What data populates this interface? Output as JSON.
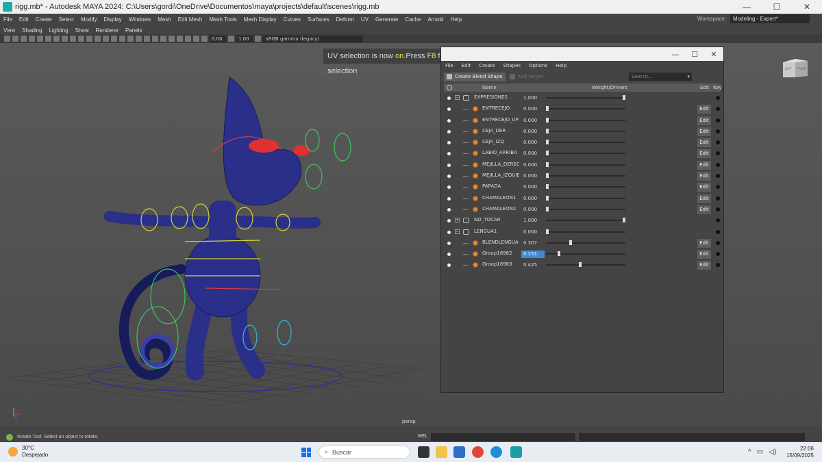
{
  "window": {
    "title": "rigg.mb* - Autodesk MAYA 2024: C:\\Users\\gordi\\OneDrive\\Documentos\\maya\\projects\\default\\scenes\\rigg.mb",
    "minimize": "—",
    "maximize": "☐",
    "close": "✕"
  },
  "menubar": [
    "File",
    "Edit",
    "Create",
    "Select",
    "Modify",
    "Display",
    "Windows",
    "Mesh",
    "Edit Mesh",
    "Mesh Tools",
    "Mesh Display",
    "Curves",
    "Surfaces",
    "Deform",
    "UV",
    "Generate",
    "Cache",
    "Arnold",
    "Help"
  ],
  "workspace": {
    "label": "Workspace:",
    "value": "Modeling - Expert*"
  },
  "panel_menu": [
    "View",
    "Shading",
    "Lighting",
    "Show",
    "Renderer",
    "Panels"
  ],
  "toolbar": {
    "field1": "0.00",
    "field2": "1.00",
    "colorspace": "sRGB gamma (legacy)"
  },
  "viewport": {
    "hud_prefix": "UV selection is now ",
    "hud_on": "on.",
    "hud_mid": "Press ",
    "hud_key": "F8",
    "hud_suffix": " for object selection",
    "camera": "persp",
    "viewcube_left": "LEFT",
    "viewcube_front": "FRONT"
  },
  "shape_editor": {
    "menu": [
      "File",
      "Edit",
      "Create",
      "Shapes",
      "Options",
      "Help"
    ],
    "create_blend": "Create Blend Shape",
    "add_target": "Add Target",
    "search_placeholder": "Search...",
    "headers": {
      "name": "Name",
      "weight": "Weight/Drivers",
      "edit": "Edit",
      "key": "Key"
    },
    "edit_label": "Edit",
    "rows": [
      {
        "type": "group",
        "name": "EXPRESIONES",
        "value": "1.000",
        "weight": 1.0,
        "expanded": true
      },
      {
        "type": "target",
        "name": "ENTRECEJO",
        "value": "0.000",
        "weight": 0.0
      },
      {
        "type": "target",
        "name": "ENTRECEJO_UP",
        "value": "0.000",
        "weight": 0.0
      },
      {
        "type": "target",
        "name": "CEJA_DER",
        "value": "0.000",
        "weight": 0.0
      },
      {
        "type": "target",
        "name": "CEJA_IZQ",
        "value": "0.000",
        "weight": 0.0
      },
      {
        "type": "target",
        "name": "LABIO_ARRIBA",
        "value": "0.000",
        "weight": 0.0
      },
      {
        "type": "target",
        "name": "MEJILLA_DERECH",
        "value": "0.000",
        "weight": 0.0
      },
      {
        "type": "target",
        "name": "MEJILLA_IZQUIER",
        "value": "0.000",
        "weight": 0.0
      },
      {
        "type": "target",
        "name": "PAPADA",
        "value": "0.000",
        "weight": 0.0
      },
      {
        "type": "target",
        "name": "CHAMALEON1",
        "value": "0.000",
        "weight": 0.0
      },
      {
        "type": "target",
        "name": "CHAMALEON2",
        "value": "0.000",
        "weight": 0.0
      },
      {
        "type": "group",
        "name": "NO_TOCAR",
        "value": "1.000",
        "weight": 1.0,
        "expanded": false
      },
      {
        "type": "group",
        "name": "LENGUA1",
        "value": "0.000",
        "weight": 0.0,
        "expanded": true
      },
      {
        "type": "target",
        "name": "BLENDLENGUA",
        "value": "0.307",
        "weight": 0.307
      },
      {
        "type": "target",
        "name": "Group18982",
        "value": "0.151",
        "weight": 0.151,
        "selected": true
      },
      {
        "type": "target",
        "name": "Group18983",
        "value": "0.425",
        "weight": 0.425
      }
    ]
  },
  "statusline": {
    "help": "Rotate Tool: Select an object to rotate.",
    "mel": "MEL"
  },
  "taskbar": {
    "temp": "30°C",
    "weather": "Despejado",
    "search": "Buscar",
    "time": "22:06",
    "date": "15/09/2025",
    "tray_up": "^",
    "tray_net": "▭",
    "tray_vol": "◁)"
  },
  "colors": {
    "accent": "#3d8ad6",
    "hud_highlight": "#f5e050",
    "target_icon": "#d98b3a",
    "mesh": "#2a2f8a"
  }
}
